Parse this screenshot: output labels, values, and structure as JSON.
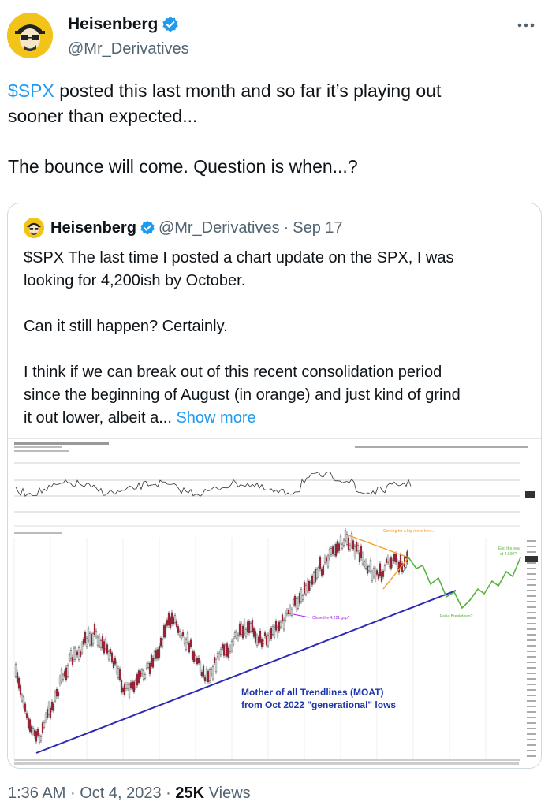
{
  "author": {
    "display_name": "Heisenberg",
    "handle": "@Mr_Derivatives",
    "avatar_icon": "heisenberg-avatar-icon",
    "verified_icon": "verified-badge-icon",
    "accent": "#1d9bf0"
  },
  "tweet": {
    "cashtag": "$SPX",
    "line1_rest": " posted this last month and so far it’s playing out",
    "line2": "sooner than expected...",
    "line3": "The bounce will come. Question is when...?"
  },
  "quoted": {
    "display_name": "Heisenberg",
    "handle": "@Mr_Derivatives",
    "dot": "·",
    "date": "Sep 17",
    "p1_line1": "$SPX The last time I posted a chart update on the SPX, I was",
    "p1_line2": "looking for 4,200ish by October.",
    "p2": "Can it still happen? Certainly.",
    "p3_line1": "I think if we can break out of this recent consolidation period",
    "p3_line2": "since the beginning of August (in orange) and just kind of grind",
    "p3_line3": "it out lower, albeit a...",
    "show_more": "Show more"
  },
  "chart_annotations": {
    "moat_line1": "Mother of all Trendlines (MOAT)",
    "moat_line2": "from Oct 2022 \"generational\" lows",
    "orange_note": "Coming for a big move here...",
    "purple_note": "Close the 4,221 gap?",
    "green_note_1": "False Breakdown?",
    "green_note_2": "End the year",
    "green_note_3": "at 4,600?"
  },
  "meta": {
    "time": "1:36 AM",
    "dot": "·",
    "date": "Oct 4, 2023",
    "views_count": "25K",
    "views_label": " Views"
  }
}
